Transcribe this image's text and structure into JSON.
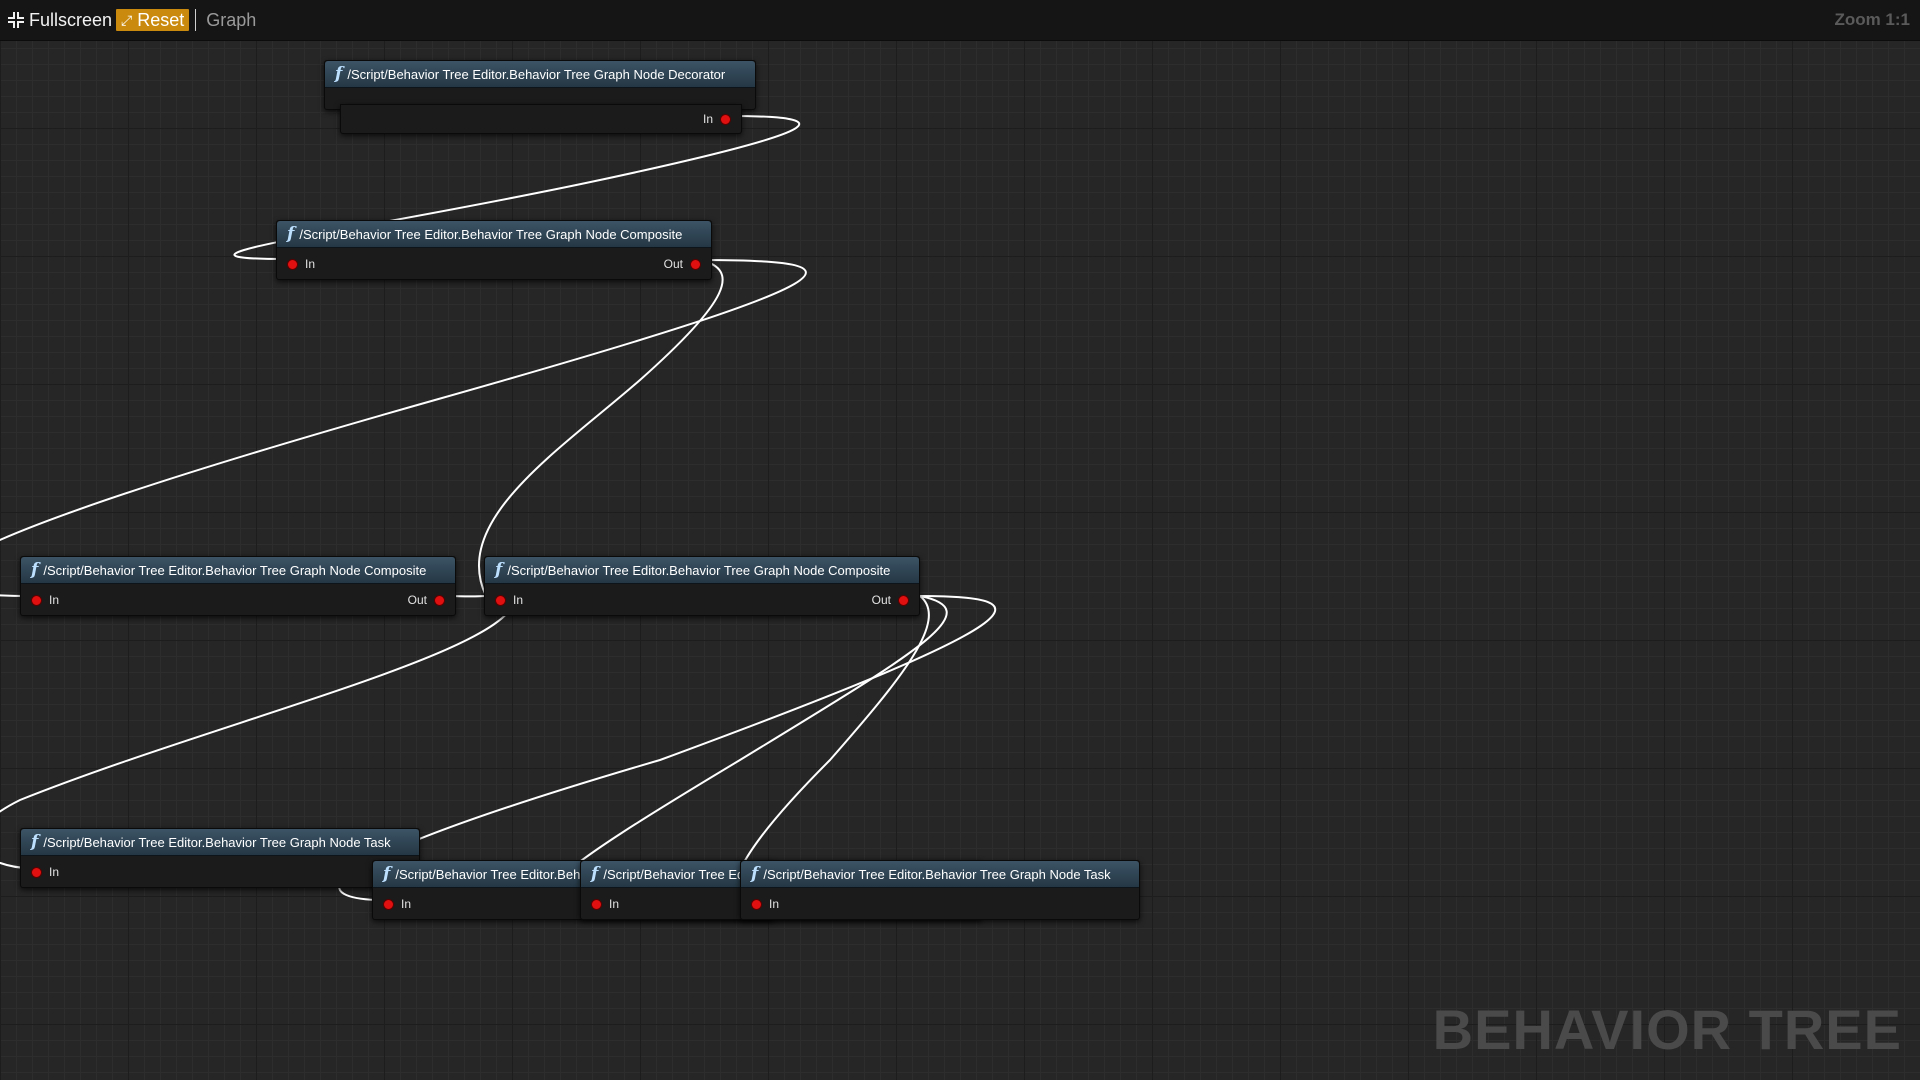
{
  "toolbar": {
    "fullscreen_label": "Fullscreen",
    "reset_label": "Reset",
    "graph_label": "Graph",
    "zoom_label": "Zoom 1:1"
  },
  "watermark": "BEHAVIOR TREE",
  "nodes": {
    "decorator": {
      "title": "/Script/Behavior Tree Editor.Behavior Tree Graph Node Decorator",
      "in": "In"
    },
    "composite_top": {
      "title": "/Script/Behavior Tree Editor.Behavior Tree Graph Node Composite",
      "in": "In",
      "out": "Out"
    },
    "composite_left": {
      "title": "/Script/Behavior Tree Editor.Behavior Tree Graph Node Composite",
      "in": "In",
      "out": "Out"
    },
    "composite_mid": {
      "title": "/Script/Behavior Tree Editor.Behavior Tree Graph Node Composite",
      "in": "In",
      "out": "Out"
    },
    "task_1": {
      "title": "/Script/Behavior Tree Editor.Behavior Tree Graph Node Task",
      "in": "In"
    },
    "task_2": {
      "title": "/Script/Behavior Tree Editor.Behavior Tree Graph Node Task",
      "in": "In"
    },
    "task_3": {
      "title": "/Script/Behavior Tree Editor.Behavior Tree Graph Node Task",
      "in": "In"
    },
    "task_4": {
      "title": "/Script/Behavior Tree Editor.Behavior Tree Graph Node Task",
      "in": "In"
    }
  },
  "colors": {
    "canvas": "#262626",
    "node_header": "#2f4656",
    "pin": "#e01010",
    "reset_button": "#c98a0e",
    "wire": "#ffffff"
  }
}
